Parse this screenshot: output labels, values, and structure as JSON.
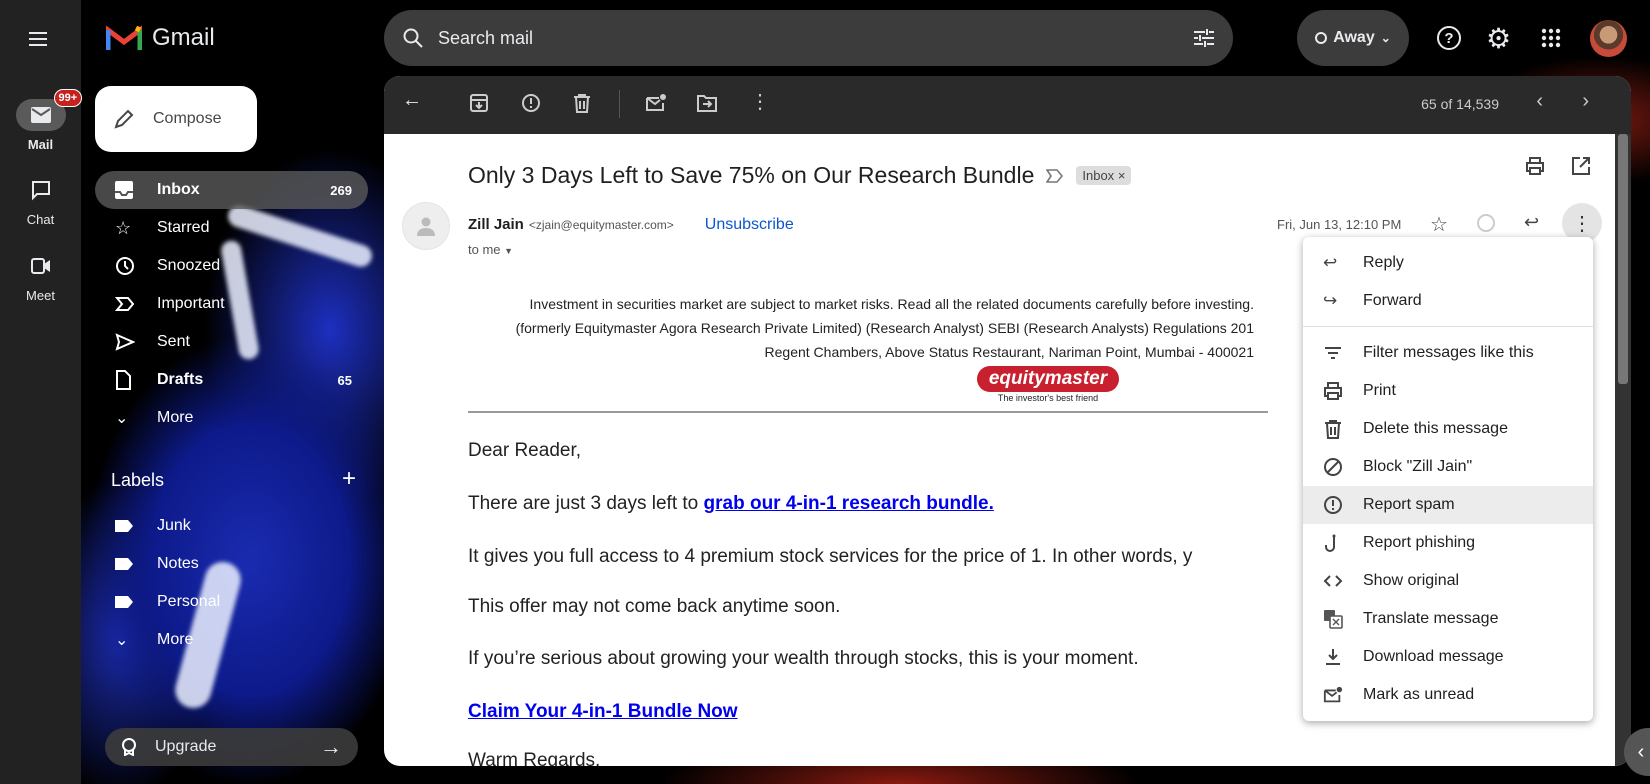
{
  "app": {
    "name": "Gmail"
  },
  "rail": [
    {
      "label": "Mail",
      "badge": "99+"
    },
    {
      "label": "Chat"
    },
    {
      "label": "Meet"
    }
  ],
  "compose": "Compose",
  "nav": [
    {
      "label": "Inbox",
      "count": "269"
    },
    {
      "label": "Starred"
    },
    {
      "label": "Snoozed"
    },
    {
      "label": "Important"
    },
    {
      "label": "Sent"
    },
    {
      "label": "Drafts",
      "count": "65"
    },
    {
      "label": "More"
    }
  ],
  "labels": {
    "title": "Labels",
    "items": [
      "Junk",
      "Notes",
      "Personal"
    ],
    "more": "More"
  },
  "upgrade": "Upgrade",
  "search": {
    "placeholder": "Search mail"
  },
  "status": "Away",
  "pagination": "65 of 14,539",
  "email": {
    "subject": "Only 3 Days Left to Save 75% on Our Research Bundle",
    "label_chip": "Inbox",
    "sender_name": "Zill Jain",
    "sender_email": "<zjain@equitymaster.com>",
    "unsubscribe": "Unsubscribe",
    "to": "to me",
    "date": "Fri, Jun 13, 12:10 PM",
    "disclaimer": [
      "Investment in securities market are subject to market risks. Read all the related documents carefully before investing.",
      "(formerly Equitymaster Agora Research Private Limited) (Research Analyst) SEBI (Research Analysts) Regulations 201",
      "Regent Chambers, Above Status Restaurant, Nariman Point, Mumbai - 400021"
    ],
    "logo": {
      "name": "equitymaster",
      "tagline": "The investor's best friend"
    },
    "greeting": "Dear Reader,",
    "p1_pre": "There are just 3 days left to ",
    "p1_link": "grab our 4-in-1 research bundle.",
    "p2": "It gives you full access to 4 premium stock services for the price of 1. In other words, y",
    "p3": "This offer may not come back anytime soon.",
    "p4": "If you’re serious about growing your wealth through stocks, this is your moment.",
    "cta": "Claim Your 4-in-1 Bundle Now",
    "signoff": "Warm Regards,"
  },
  "menu": [
    "Reply",
    "Forward",
    "Filter messages like this",
    "Print",
    "Delete this message",
    "Block \"Zill Jain\"",
    "Report spam",
    "Report phishing",
    "Show original",
    "Translate message",
    "Download message",
    "Mark as unread"
  ],
  "colors": {
    "accent_link": "#0b57d0",
    "badge": "#c5221f",
    "logo_red": "#c8202f"
  }
}
